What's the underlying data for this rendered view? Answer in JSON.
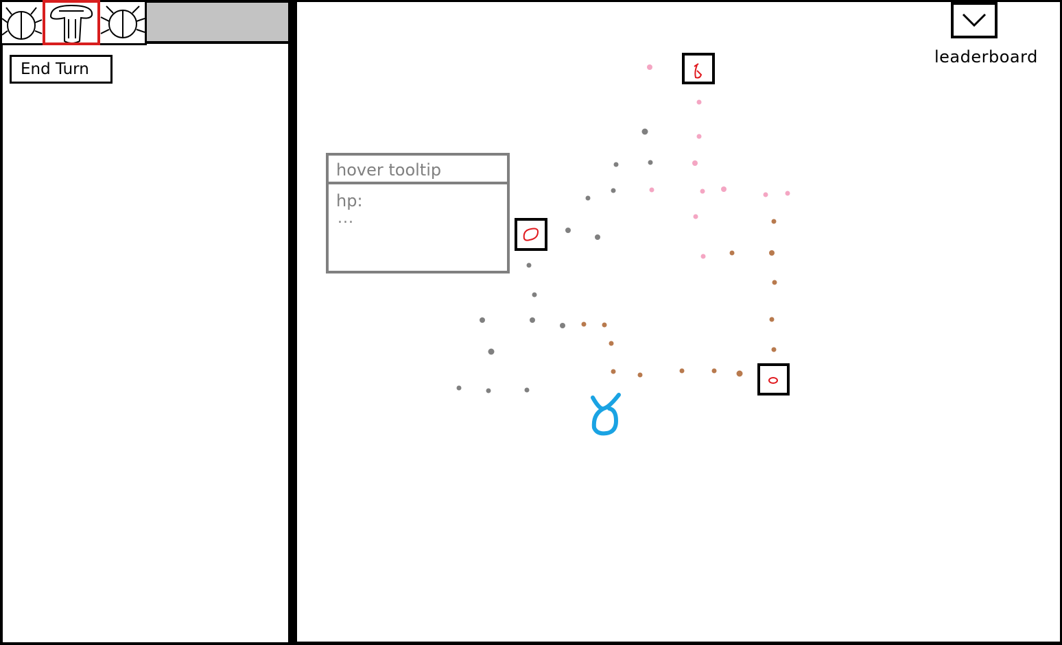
{
  "hud": {
    "end_turn_label": "End Turn",
    "units": [
      {
        "icon": "bug-icon",
        "selected": false
      },
      {
        "icon": "mushroom-icon",
        "selected": true
      },
      {
        "icon": "bug-icon",
        "selected": false
      }
    ]
  },
  "map": {
    "leaderboard_label": "leaderboard",
    "leaderboard_icon": "chevron-down-icon",
    "tooltip": {
      "title": "hover tooltip",
      "hp_label": "hp:",
      "more": "..."
    },
    "nodes": [
      {
        "name": "map-node-top",
        "icon": "enemy-glyph-icon"
      },
      {
        "name": "map-node-left",
        "icon": "enemy-blob-icon"
      },
      {
        "name": "map-node-right",
        "icon": "enemy-blob-icon"
      }
    ],
    "player_icon": "player-creature-icon",
    "path_colors": {
      "gray": "#808080",
      "pink": "#f4a6c3",
      "brown": "#b87a4e"
    },
    "node_glyph_color": "#e0191e",
    "player_color": "#1aa3e3",
    "selected_color": "#d81e1e"
  }
}
